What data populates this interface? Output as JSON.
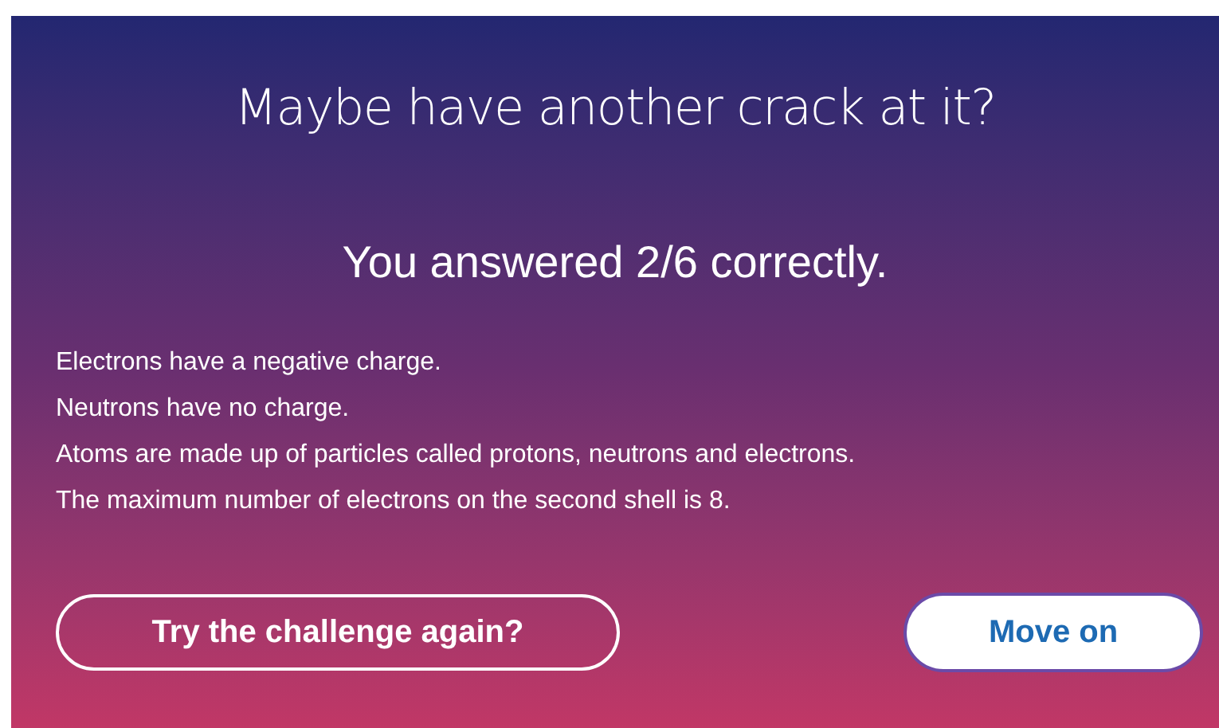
{
  "title": "Maybe have another crack at it?",
  "score": "You answered 2/6 correctly.",
  "feedback": [
    "Electrons have a negative charge.",
    "Neutrons have no charge.",
    "Atoms are made up of particles called protons, neutrons and electrons.",
    "The maximum number of electrons on the second shell is 8."
  ],
  "buttons": [
    {
      "label": "Try the challenge again?",
      "kind": "outline"
    },
    {
      "label": "Move on",
      "kind": "filled"
    }
  ]
}
